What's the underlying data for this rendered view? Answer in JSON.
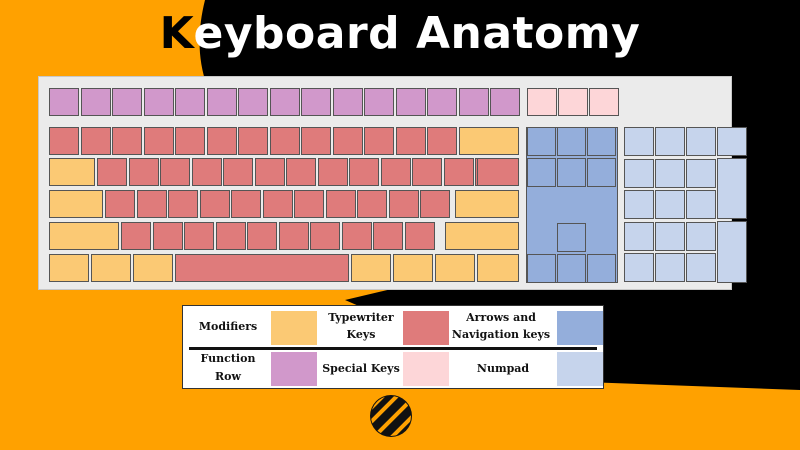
{
  "title": {
    "first_letter": "K",
    "rest": "eyboard Anatomy"
  },
  "colors": {
    "modifiers": "#fbc974",
    "typewriter": "#df7b7b",
    "function_row": "#d198cb",
    "special": "#fdd6d8",
    "navigation": "#94aedb",
    "numpad": "#c6d4ec",
    "bg_orange": "#ffa100",
    "bg_black": "#000000"
  },
  "legend": {
    "modifiers": "Modifiers",
    "typewriter_1": "Typewriter",
    "typewriter_2": "Keys",
    "arrows_1": "Arrows and",
    "arrows_2": "Navigation keys",
    "function_1": "Function",
    "function_2": "Row",
    "special": "Special Keys",
    "numpad": "Numpad"
  },
  "logo_icon": "striped-circle-logo"
}
